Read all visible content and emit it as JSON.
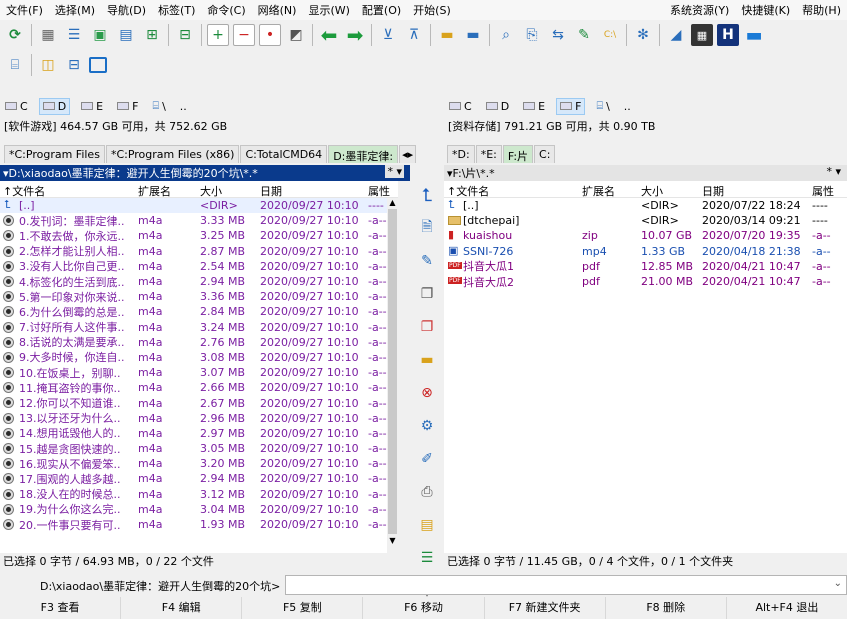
{
  "menu": {
    "items": [
      "文件(F)",
      "选择(M)",
      "导航(D)",
      "标签(T)",
      "命令(C)",
      "网络(N)",
      "显示(W)",
      "配置(O)",
      "开始(S)"
    ],
    "right": [
      "系统资源(Y)",
      "快捷键(K)",
      "帮助(H)"
    ]
  },
  "left": {
    "drives": [
      "C",
      "D",
      "E",
      "F",
      "\\",
      ".."
    ],
    "free": "[软件游戏] 464.57 GB 可用，共 752.62 GB",
    "tabs": [
      "*C:Program Files",
      "*C:Program Files (x86)",
      "C:TotalCMD64",
      "D:墨菲定律:"
    ],
    "path": "▾D:\\xiaodao\\墨菲定律：避开人生倒霉的20个坑\\*.*",
    "filter": "* ▾",
    "headers": {
      "name": "↑文件名",
      "ext": "扩展名",
      "size": "大小",
      "date": "日期",
      "attr": "属性"
    },
    "rows": [
      {
        "name": "[..]",
        "ext": "",
        "size": "<DIR>",
        "date": "2020/09/27 10:10",
        "attr": "----",
        "up": true
      },
      {
        "name": "0.发刊词：墨菲定律..",
        "ext": "m4a",
        "size": "3.33 MB",
        "date": "2020/09/27 10:10",
        "attr": "-a--"
      },
      {
        "name": "1.不敢去做，你永远..",
        "ext": "m4a",
        "size": "3.25 MB",
        "date": "2020/09/27 10:10",
        "attr": "-a--"
      },
      {
        "name": "2.怎样才能让别人相..",
        "ext": "m4a",
        "size": "2.87 MB",
        "date": "2020/09/27 10:10",
        "attr": "-a--"
      },
      {
        "name": "3.没有人比你自己更..",
        "ext": "m4a",
        "size": "2.54 MB",
        "date": "2020/09/27 10:10",
        "attr": "-a--"
      },
      {
        "name": "4.标签化的生活到底..",
        "ext": "m4a",
        "size": "2.94 MB",
        "date": "2020/09/27 10:10",
        "attr": "-a--"
      },
      {
        "name": "5.第一印象对你来说..",
        "ext": "m4a",
        "size": "3.36 MB",
        "date": "2020/09/27 10:10",
        "attr": "-a--"
      },
      {
        "name": "6.为什么倒霉的总是..",
        "ext": "m4a",
        "size": "2.84 MB",
        "date": "2020/09/27 10:10",
        "attr": "-a--"
      },
      {
        "name": "7.讨好所有人这件事..",
        "ext": "m4a",
        "size": "3.24 MB",
        "date": "2020/09/27 10:10",
        "attr": "-a--"
      },
      {
        "name": "8.话说的太满是要承..",
        "ext": "m4a",
        "size": "2.76 MB",
        "date": "2020/09/27 10:10",
        "attr": "-a--"
      },
      {
        "name": "9.大多时候，你连自..",
        "ext": "m4a",
        "size": "3.08 MB",
        "date": "2020/09/27 10:10",
        "attr": "-a--"
      },
      {
        "name": "10.在饭桌上，别聊..",
        "ext": "m4a",
        "size": "3.07 MB",
        "date": "2020/09/27 10:10",
        "attr": "-a--"
      },
      {
        "name": "11.掩耳盗铃的事你..",
        "ext": "m4a",
        "size": "2.66 MB",
        "date": "2020/09/27 10:10",
        "attr": "-a--"
      },
      {
        "name": "12.你可以不知道谁..",
        "ext": "m4a",
        "size": "2.67 MB",
        "date": "2020/09/27 10:10",
        "attr": "-a--"
      },
      {
        "name": "13.以牙还牙为什么..",
        "ext": "m4a",
        "size": "2.96 MB",
        "date": "2020/09/27 10:10",
        "attr": "-a--"
      },
      {
        "name": "14.想用诋毁他人的..",
        "ext": "m4a",
        "size": "2.97 MB",
        "date": "2020/09/27 10:10",
        "attr": "-a--"
      },
      {
        "name": "15.越是贪图快速的..",
        "ext": "m4a",
        "size": "3.05 MB",
        "date": "2020/09/27 10:10",
        "attr": "-a--"
      },
      {
        "name": "16.现实从不偏爱笨..",
        "ext": "m4a",
        "size": "3.20 MB",
        "date": "2020/09/27 10:10",
        "attr": "-a--"
      },
      {
        "name": "17.围观的人越多越..",
        "ext": "m4a",
        "size": "2.94 MB",
        "date": "2020/09/27 10:10",
        "attr": "-a--"
      },
      {
        "name": "18.没人在的时候总..",
        "ext": "m4a",
        "size": "3.12 MB",
        "date": "2020/09/27 10:10",
        "attr": "-a--"
      },
      {
        "name": "19.为什么你这么完..",
        "ext": "m4a",
        "size": "3.04 MB",
        "date": "2020/09/27 10:10",
        "attr": "-a--"
      },
      {
        "name": "20.一件事只要有可..",
        "ext": "m4a",
        "size": "1.93 MB",
        "date": "2020/09/27 10:10",
        "attr": "-a--"
      }
    ],
    "status": "已选择 0 字节 / 64.93 MB，0 / 22 个文件"
  },
  "right": {
    "drives": [
      "C",
      "D",
      "E",
      "F",
      "\\",
      ".."
    ],
    "free": "[资料存储] 791.21 GB 可用，共 0.90 TB",
    "tabs": [
      "*D:",
      "*E:",
      "F:片",
      "C:"
    ],
    "path": "▾F:\\片\\*.*",
    "filter": "* ▾",
    "headers": {
      "name": "↑文件名",
      "ext": "扩展名",
      "size": "大小",
      "date": "日期",
      "attr": "属性"
    },
    "rows": [
      {
        "name": "[..]",
        "ext": "",
        "size": "<DIR>",
        "date": "2020/07/22 18:24",
        "attr": "----",
        "up": true
      },
      {
        "name": "[dtchepai]",
        "ext": "",
        "size": "<DIR>",
        "date": "2020/03/14 09:21",
        "attr": "----",
        "folder": true
      },
      {
        "name": "kuaishou",
        "ext": "zip",
        "size": "10.07 GB",
        "date": "2020/07/20 19:35",
        "attr": "-a--"
      },
      {
        "name": "SSNI-726",
        "ext": "mp4",
        "size": "1.33 GB",
        "date": "2020/04/18 21:38",
        "attr": "-a--"
      },
      {
        "name": "抖音大瓜1",
        "ext": "pdf",
        "size": "12.85 MB",
        "date": "2020/04/21 10:47",
        "attr": "-a--"
      },
      {
        "name": "抖音大瓜2",
        "ext": "pdf",
        "size": "21.00 MB",
        "date": "2020/04/21 10:47",
        "attr": "-a--"
      }
    ],
    "status": "已选择 0 字节 / 11.45 GB，0 / 4 个文件，0 / 1 个文件夹"
  },
  "cmd": {
    "label": "D:\\xiaodao\\墨菲定律：避开人生倒霉的20个坑>"
  },
  "fkeys": [
    "F3 查看",
    "F4 编辑",
    "F5 复制",
    "F6 移动",
    "F7 新建文件夹",
    "F8 删除",
    "Alt+F4 退出"
  ]
}
